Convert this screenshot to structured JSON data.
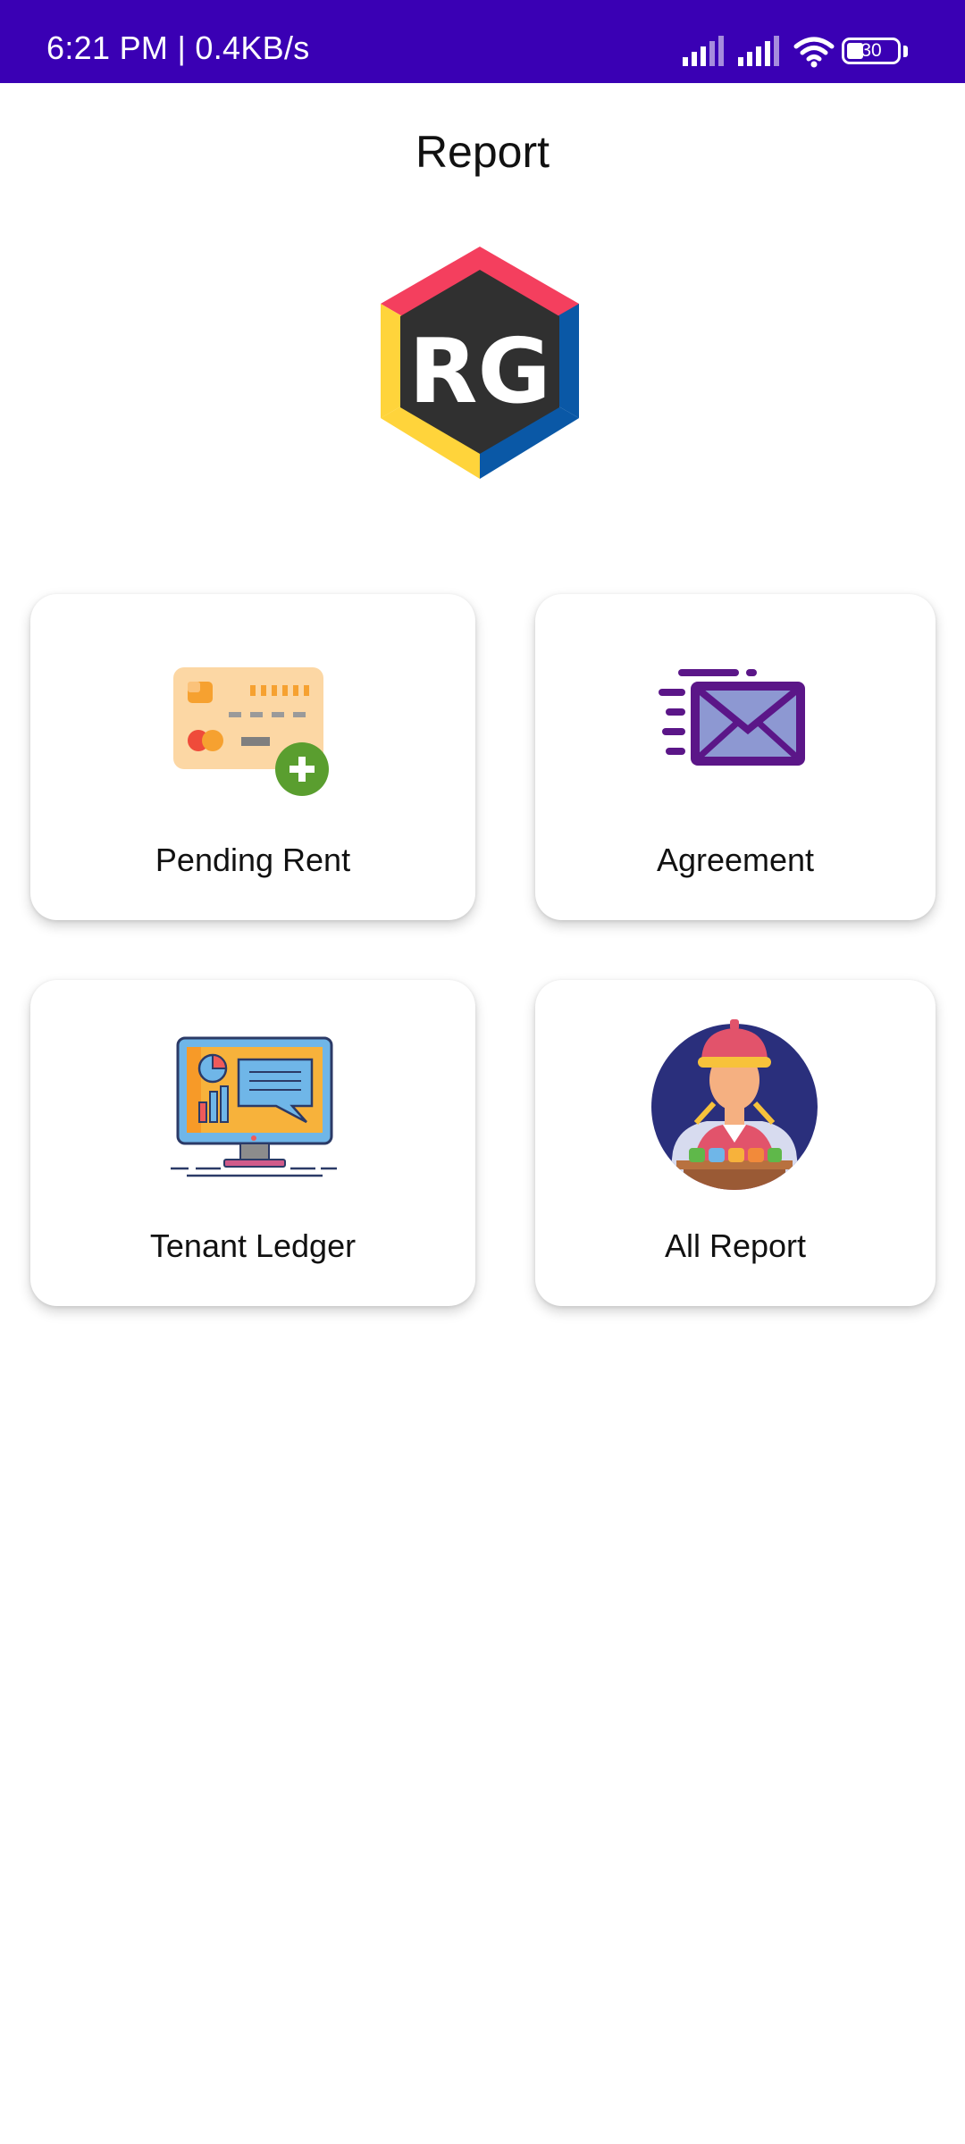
{
  "status_bar": {
    "time_speed": "6:21 PM | 0.4KB/s",
    "battery_level": "30",
    "icons": [
      "signal-icon",
      "signal-icon",
      "wifi-icon",
      "battery-icon"
    ]
  },
  "header": {
    "title": "Report"
  },
  "logo": {
    "text": "RG"
  },
  "menu": {
    "items": [
      {
        "label": "Pending Rent",
        "icon": "credit-card-add-icon"
      },
      {
        "label": "Agreement",
        "icon": "envelope-icon"
      },
      {
        "label": "Tenant Ledger",
        "icon": "monitor-report-icon"
      },
      {
        "label": "All Report",
        "icon": "vendor-person-icon"
      }
    ]
  },
  "colors": {
    "status_bar": "#3a00b4",
    "logo_red": "#f43f5e",
    "logo_blue": "#0a58a6",
    "logo_yellow": "#ffd43b",
    "logo_dark": "#303030"
  }
}
